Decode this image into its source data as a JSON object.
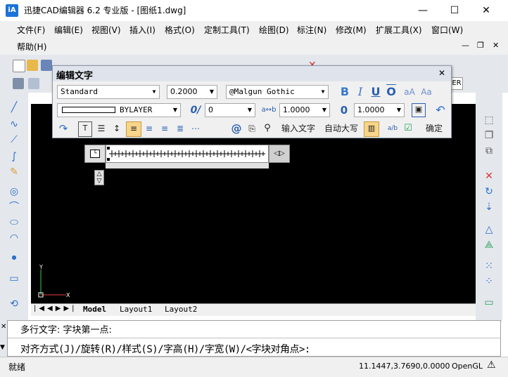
{
  "window": {
    "icon_label": "iA",
    "title": "迅捷CAD编辑器 6.2 专业版  - [图纸1.dwg]",
    "minimize_glyph": "—",
    "maximize_glyph": "☐",
    "close_glyph": "✕"
  },
  "menu": {
    "row1": [
      "文件(F)",
      "编辑(E)",
      "视图(V)",
      "插入(I)",
      "格式(O)",
      "定制工具(T)",
      "绘图(D)",
      "标注(N)",
      "修改(M)",
      "扩展工具(X)",
      "窗口(W)"
    ],
    "row2": [
      "帮助(H)"
    ],
    "doc_min": "—",
    "doc_restore": "❐",
    "doc_close": "✕"
  },
  "dialog": {
    "title": "编辑文字",
    "close_glyph": "✕",
    "style_value": "Standard",
    "height_value": "0.2000",
    "font_value": "@Malgun Gothic",
    "color_value": "BYLAYER",
    "oblique_value": "0",
    "tracking_value": "1.0000",
    "width_value": "1.0000",
    "bold_glyph": "B",
    "italic_glyph": "I",
    "underline_glyph": "U",
    "overline_glyph": "O",
    "upper_glyph": "aA",
    "lower_glyph": "Aa",
    "oblique_glyph": "0/",
    "tracking_glyph": "a↔b",
    "width_glyph": "0",
    "symbol_glyph": "@",
    "insert_text_label": "输入文字",
    "auto_caps_label": "自动大写",
    "ok_label": "确定",
    "fraction_glyph": "a/b"
  },
  "tabs": {
    "model": "Model",
    "layout1": "Layout1",
    "layout2": "Layout2"
  },
  "ucs": {
    "x_label": "X",
    "y_label": "Y"
  },
  "command": {
    "line1": "多行文字: 字块第一点:",
    "line2": "对齐方式(J)/旋转(R)/样式(S)/字高(H)/字宽(W)/<字块对角点>:"
  },
  "status": {
    "state": "就绪",
    "coords": "11.1447,3.7690,0.0000",
    "renderer": "OpenGL"
  },
  "colors": {
    "accent": "#1b73d6",
    "canvas": "#000000",
    "highlight": "#f7d58a"
  }
}
